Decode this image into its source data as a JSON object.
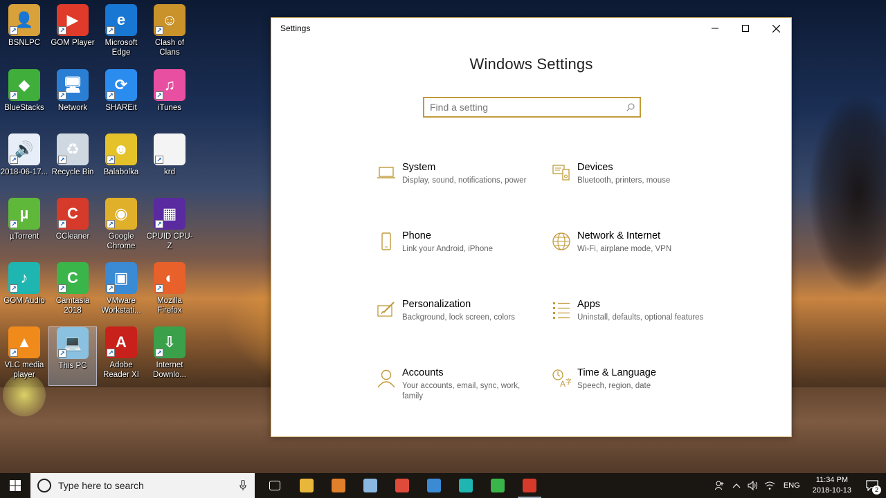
{
  "desktop": {
    "icons": [
      {
        "label": "BSNLPC",
        "color": "#d9a13a",
        "glyph": "👤"
      },
      {
        "label": "GOM Player",
        "color": "#e03a2a",
        "glyph": "▶"
      },
      {
        "label": "Microsoft Edge",
        "color": "#1877d2",
        "glyph": "e"
      },
      {
        "label": "Clash of Clans",
        "color": "#c9922a",
        "glyph": "☺"
      },
      {
        "label": "BlueStacks",
        "color": "#3fae3a",
        "glyph": "◆"
      },
      {
        "label": "Network",
        "color": "#2a7fd4",
        "glyph": "🖥"
      },
      {
        "label": "SHAREit",
        "color": "#2b8cf0",
        "glyph": "⟳"
      },
      {
        "label": "iTunes",
        "color": "#e84fa0",
        "glyph": "♫"
      },
      {
        "label": "2018-06-17...",
        "color": "#e8eef8",
        "glyph": "🔊"
      },
      {
        "label": "Recycle Bin",
        "color": "#cfd8e0",
        "glyph": "♻"
      },
      {
        "label": "Balabolka",
        "color": "#e6c22a",
        "glyph": "☻"
      },
      {
        "label": "krd",
        "color": "#f4f4f4",
        "glyph": ""
      },
      {
        "label": "µTorrent",
        "color": "#5fb83a",
        "glyph": "µ"
      },
      {
        "label": "CCleaner",
        "color": "#d63a2a",
        "glyph": "C"
      },
      {
        "label": "Google Chrome",
        "color": "#e0b02a",
        "glyph": "◉"
      },
      {
        "label": "CPUID CPU-Z",
        "color": "#5a2aa0",
        "glyph": "▦"
      },
      {
        "label": "GOM Audio",
        "color": "#1fb5b0",
        "glyph": "♪"
      },
      {
        "label": "Camtasia 2018",
        "color": "#3ab54a",
        "glyph": "C"
      },
      {
        "label": "VMware Workstati...",
        "color": "#3a8ad4",
        "glyph": "▣"
      },
      {
        "label": "Mozilla Firefox",
        "color": "#e8602a",
        "glyph": "◐"
      },
      {
        "label": "VLC media player",
        "color": "#f08a1a",
        "glyph": "▲"
      },
      {
        "label": "This PC",
        "color": "#8ac0e0",
        "glyph": "💻"
      },
      {
        "label": "Adobe Reader XI",
        "color": "#c8201a",
        "glyph": "A"
      },
      {
        "label": "Internet Downlo...",
        "color": "#3aa04a",
        "glyph": "⇩"
      }
    ]
  },
  "window": {
    "title": "Settings",
    "heading": "Windows Settings",
    "search_placeholder": "Find a setting",
    "categories": [
      {
        "name": "System",
        "desc": "Display, sound, notifications, power",
        "icon": "laptop-icon"
      },
      {
        "name": "Devices",
        "desc": "Bluetooth, printers, mouse",
        "icon": "devices-icon"
      },
      {
        "name": "Phone",
        "desc": "Link your Android, iPhone",
        "icon": "phone-icon"
      },
      {
        "name": "Network & Internet",
        "desc": "Wi-Fi, airplane mode, VPN",
        "icon": "globe-icon"
      },
      {
        "name": "Personalization",
        "desc": "Background, lock screen, colors",
        "icon": "paintbrush-icon"
      },
      {
        "name": "Apps",
        "desc": "Uninstall, defaults, optional features",
        "icon": "apps-list-icon"
      },
      {
        "name": "Accounts",
        "desc": "Your accounts, email, sync, work, family",
        "icon": "person-icon"
      },
      {
        "name": "Time & Language",
        "desc": "Speech, region, date",
        "icon": "time-language-icon"
      }
    ],
    "accent": "#c19a3a"
  },
  "taskbar": {
    "search_text": "Type here to search",
    "apps": [
      {
        "name": "task-view",
        "color": "#ffffff"
      },
      {
        "name": "file-explorer",
        "color": "#e8b63a"
      },
      {
        "name": "gom-player",
        "color": "#e0802a"
      },
      {
        "name": "app-blue",
        "color": "#8ab8e0"
      },
      {
        "name": "chrome",
        "color": "#e04a3a"
      },
      {
        "name": "vmware",
        "color": "#3a8ad4"
      },
      {
        "name": "gom-audio",
        "color": "#1fb5b0"
      },
      {
        "name": "camtasia",
        "color": "#3ab54a"
      },
      {
        "name": "ccleaner",
        "color": "#d63a2a"
      }
    ],
    "lang": "ENG",
    "time": "11:34 PM",
    "date": "2018-10-13",
    "notif_count": "2"
  }
}
